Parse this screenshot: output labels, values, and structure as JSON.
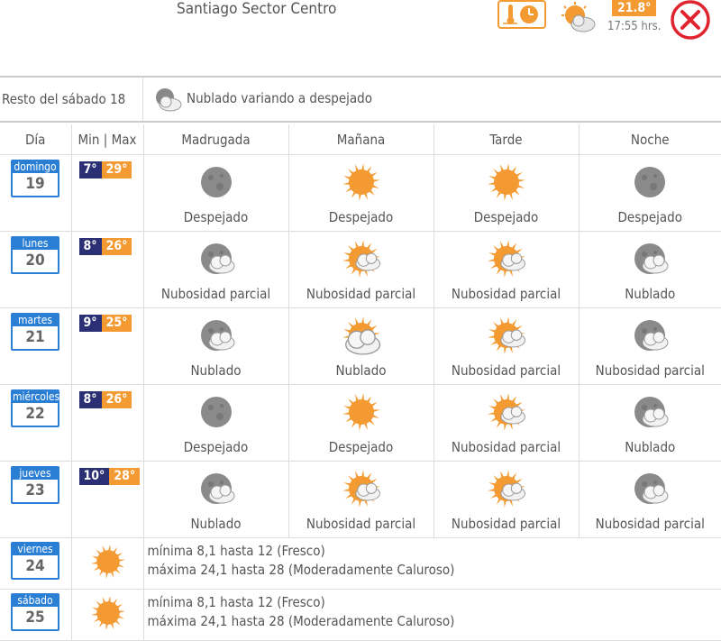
{
  "location": "Santiago Sector Centro",
  "current": {
    "temp": "21.8°",
    "time": "17:55 hrs.",
    "icon": "partly-cloudy-icon"
  },
  "resto": {
    "label": "Resto del sábado 18",
    "icon": "cloudy-night-icon",
    "desc": "Nublado variando a despejado"
  },
  "headers": [
    "Día",
    "Min | Max",
    "Madrugada",
    "Mañana",
    "Tarde",
    "Noche"
  ],
  "days": [
    {
      "name": "domingo",
      "num": "19",
      "min": "7°",
      "max": "29°",
      "slots": [
        {
          "icon": "moon",
          "desc": "Despejado"
        },
        {
          "icon": "sun",
          "desc": "Despejado"
        },
        {
          "icon": "sun",
          "desc": "Despejado"
        },
        {
          "icon": "moon",
          "desc": "Despejado"
        }
      ]
    },
    {
      "name": "lunes",
      "num": "20",
      "min": "8°",
      "max": "26°",
      "slots": [
        {
          "icon": "moon-cloud",
          "desc": "Nubosidad parcial"
        },
        {
          "icon": "sun-cloud",
          "desc": "Nubosidad parcial"
        },
        {
          "icon": "sun-cloud",
          "desc": "Nubosidad parcial"
        },
        {
          "icon": "moon-cloud",
          "desc": "Nublado"
        }
      ]
    },
    {
      "name": "martes",
      "num": "21",
      "min": "9°",
      "max": "25°",
      "slots": [
        {
          "icon": "moon-cloud",
          "desc": "Nublado"
        },
        {
          "icon": "sun-cloud-big",
          "desc": "Nublado"
        },
        {
          "icon": "sun-cloud",
          "desc": "Nubosidad parcial"
        },
        {
          "icon": "moon-cloud",
          "desc": "Nubosidad parcial"
        }
      ]
    },
    {
      "name": "miércoles",
      "num": "22",
      "min": "8°",
      "max": "26°",
      "slots": [
        {
          "icon": "moon",
          "desc": "Despejado"
        },
        {
          "icon": "sun",
          "desc": "Despejado"
        },
        {
          "icon": "sun-cloud",
          "desc": "Nubosidad parcial"
        },
        {
          "icon": "moon-cloud",
          "desc": "Nublado"
        }
      ]
    },
    {
      "name": "jueves",
      "num": "23",
      "min": "10°",
      "max": "28°",
      "slots": [
        {
          "icon": "moon-cloud",
          "desc": "Nublado"
        },
        {
          "icon": "sun-cloud",
          "desc": "Nubosidad parcial"
        },
        {
          "icon": "sun-cloud",
          "desc": "Nubosidad parcial"
        },
        {
          "icon": "moon-cloud",
          "desc": "Nubosidad parcial"
        }
      ]
    }
  ],
  "extended": [
    {
      "name": "viernes",
      "num": "24",
      "icon": "sun",
      "line1": "mínima 8,1 hasta 12 (Fresco)",
      "line2": "máxima 24,1 hasta 28 (Moderadamente Caluroso)"
    },
    {
      "name": "sábado",
      "num": "25",
      "icon": "sun",
      "line1": "mínima 8,1 hasta 12 (Fresco)",
      "line2": "máxima 24,1 hasta 28 (Moderadamente Caluroso)"
    }
  ],
  "colors": {
    "orange": "#f39a32",
    "navy": "#2b2f74",
    "blue": "#2a7fd4",
    "red": "#e0242f"
  }
}
